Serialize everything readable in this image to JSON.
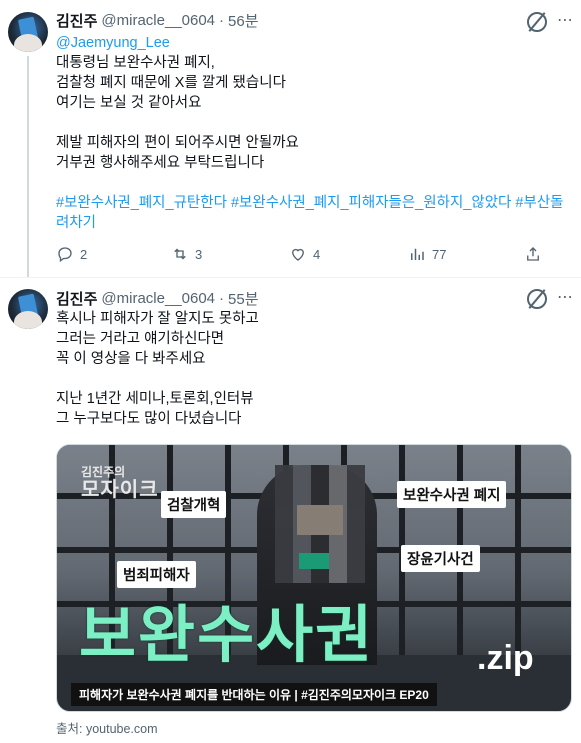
{
  "tweets": [
    {
      "author_name": "김진주",
      "handle": "@miracle__0604",
      "separator": "·",
      "time": "56분",
      "mention": "@Jaemyung_Lee",
      "body": "대통령님 보완수사권 폐지,\n검찰청 폐지 때문에 X를 깔게 됐습니다\n여기는 보실 것 같아서요\n\n제발 피해자의 편이 되어주시면 안될까요\n거부권 행사해주세요 부탁드립니다",
      "hashtags": "#보완수사권_폐지_규탄한다 #보완수사권_폐지_피해자들은_원하지_않았다 #부산돌려차기",
      "replies": "2",
      "reposts": "3",
      "likes": "4",
      "views": "77"
    },
    {
      "author_name": "김진주",
      "handle": "@miracle__0604",
      "separator": "·",
      "time": "55분",
      "body": "혹시나 피해자가 잘 알지도 못하고\n그러는 거라고 얘기하신다면\n꼭 이 영상을 다 봐주세요\n\n지난 1년간 세미나,토론회,인터뷰\n그 누구보다도 많이 다녔습니다",
      "media": {
        "brand_small": "김진주의",
        "brand_big": "모자이크",
        "label_1": "검찰개혁",
        "label_2": "보완수사권 폐지",
        "label_3": "범죄피해자",
        "label_4": "장윤기사건",
        "big_title": "보완수사권",
        "zip": ".zip",
        "caption": "피해자가 보완수사권 폐지를 반대하는 이유  |  #김진주의모자이크 EP20"
      },
      "source": "출처: youtube.com"
    }
  ],
  "colors": {
    "link": "#1d9bf0",
    "muted": "#536471",
    "text": "#0f1419",
    "mint": "#7cf0c4"
  },
  "icons": [
    "grok-icon",
    "more-icon",
    "reply-icon",
    "repost-icon",
    "like-icon",
    "views-icon",
    "share-icon"
  ]
}
